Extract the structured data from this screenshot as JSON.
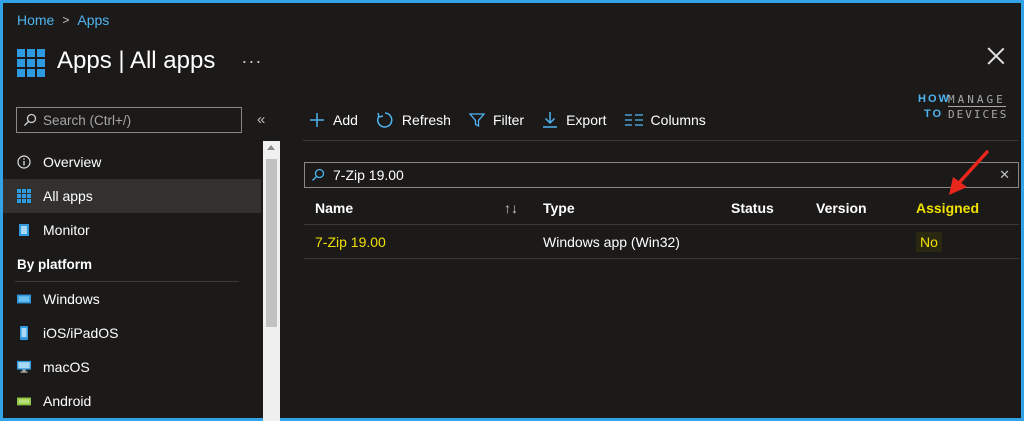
{
  "breadcrumb": {
    "home": "Home",
    "separator": ">",
    "current": "Apps"
  },
  "header": {
    "title": "Apps | All apps",
    "more": "···"
  },
  "sidebar": {
    "search_placeholder": "Search (Ctrl+/)",
    "collapse": "«",
    "items": [
      {
        "label": "Overview",
        "icon": "info-icon"
      },
      {
        "label": "All apps",
        "icon": "grid-icon",
        "active": true
      },
      {
        "label": "Monitor",
        "icon": "monitor-book-icon"
      }
    ],
    "section": "By platform",
    "platforms": [
      {
        "label": "Windows",
        "icon": "windows-device-icon"
      },
      {
        "label": "iOS/iPadOS",
        "icon": "phone-icon"
      },
      {
        "label": "macOS",
        "icon": "mac-monitor-icon"
      },
      {
        "label": "Android",
        "icon": "android-device-icon"
      }
    ]
  },
  "toolbar": {
    "add": "Add",
    "refresh": "Refresh",
    "filter": "Filter",
    "export": "Export",
    "columns": "Columns"
  },
  "logo": {
    "how": "HOW",
    "to": "TO",
    "manage": "MANAGE",
    "devices": "DEVICES"
  },
  "filter_value": "7-Zip 19.00",
  "table": {
    "headers": {
      "name": "Name",
      "sort": "↑↓",
      "type": "Type",
      "status": "Status",
      "version": "Version",
      "assigned": "Assigned"
    },
    "rows": [
      {
        "name": "7-Zip 19.00",
        "type": "Windows app (Win32)",
        "status": "",
        "version": "",
        "assigned": "No"
      }
    ]
  },
  "colors": {
    "accent": "#2f9ae0",
    "highlight": "#f0e000",
    "annotation": "#e8261c",
    "background": "#1b1a19"
  }
}
